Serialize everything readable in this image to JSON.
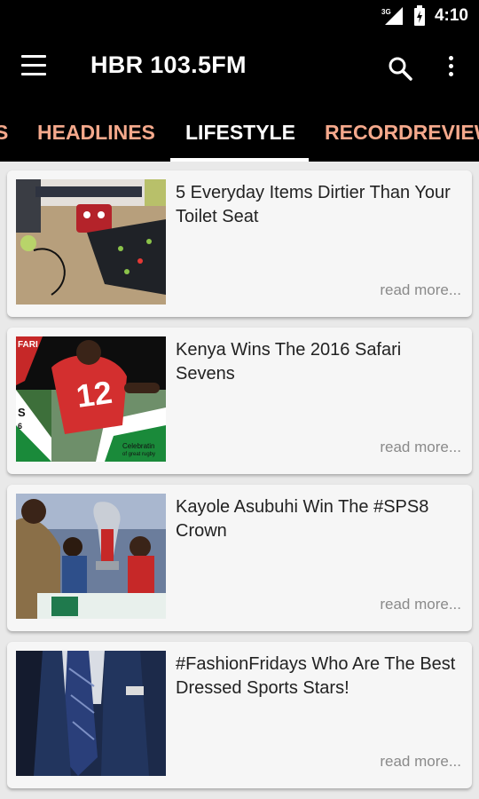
{
  "status_bar": {
    "time": "4:10",
    "network": "3G",
    "icons": [
      "signal-icon",
      "battery-icon"
    ]
  },
  "app_bar": {
    "title": "HBR 103.5FM",
    "icons": [
      "menu-icon",
      "search-icon",
      "more-vert-icon"
    ]
  },
  "tabs": [
    {
      "label": "S",
      "active": false
    },
    {
      "label": "HEADLINES",
      "active": false
    },
    {
      "label": "LIFESTYLE",
      "active": true
    },
    {
      "label": "RECORDREVIEW",
      "active": false
    }
  ],
  "colors": {
    "appbar_bg": "#000000",
    "tab_inactive": "#f5a98c",
    "tab_active": "#ffffff",
    "card_bg": "#f6f6f6",
    "list_bg": "#e9e9e9"
  },
  "articles": [
    {
      "title": "5 Everyday Items Dirtier Than Your Toilet Seat",
      "read_more": "read more...",
      "thumbnail": "keyboard-desk-photo"
    },
    {
      "title": "Kenya Wins The 2016 Safari Sevens",
      "read_more": "read more...",
      "thumbnail": "rugby-player-photo",
      "thumbnail_text": [
        "FARI",
        "S",
        "6",
        "Celebratin",
        "of great rugby"
      ]
    },
    {
      "title": "Kayole Asubuhi Win The #SPS8 Crown",
      "read_more": "read more...",
      "thumbnail": "trophy-celebration-photo"
    },
    {
      "title": "#FashionFridays Who Are The Best Dressed Sports Stars!",
      "read_more": "read more...",
      "thumbnail": "suit-and-tie-photo"
    }
  ]
}
